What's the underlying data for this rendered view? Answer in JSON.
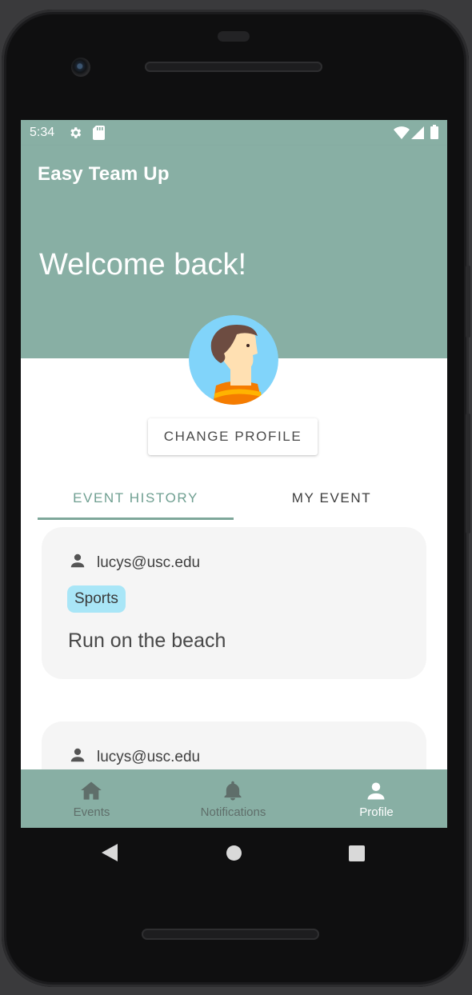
{
  "status_bar": {
    "time": "5:34",
    "left_icons": [
      "settings-icon",
      "sd-card-icon"
    ],
    "right_icons": [
      "wifi-icon",
      "signal-icon",
      "battery-icon"
    ]
  },
  "app_bar": {
    "title": "Easy Team Up"
  },
  "header": {
    "welcome_text": "Welcome back!"
  },
  "profile": {
    "change_button_label": "CHANGE PROFILE"
  },
  "tabs": [
    {
      "label": "EVENT HISTORY",
      "selected": true
    },
    {
      "label": "MY EVENT",
      "selected": false
    }
  ],
  "events": [
    {
      "email": "lucys@usc.edu",
      "tag": "Sports",
      "title": "Run on the beach"
    },
    {
      "email": "lucys@usc.edu"
    }
  ],
  "bottom_nav": [
    {
      "label": "Events",
      "icon": "home-icon",
      "selected": false
    },
    {
      "label": "Notifications",
      "icon": "bell-icon",
      "selected": false
    },
    {
      "label": "Profile",
      "icon": "person-icon",
      "selected": true
    }
  ],
  "system_nav": [
    "back-icon",
    "home-circle-icon",
    "recents-icon"
  ],
  "colors": {
    "primary": "#88afa4",
    "tab_active": "#6f9f91",
    "card_background": "#f5f5f5",
    "tag_background": "#a9e6f7",
    "nav_inactive": "#5f6e6a",
    "nav_active": "#ffffff"
  }
}
